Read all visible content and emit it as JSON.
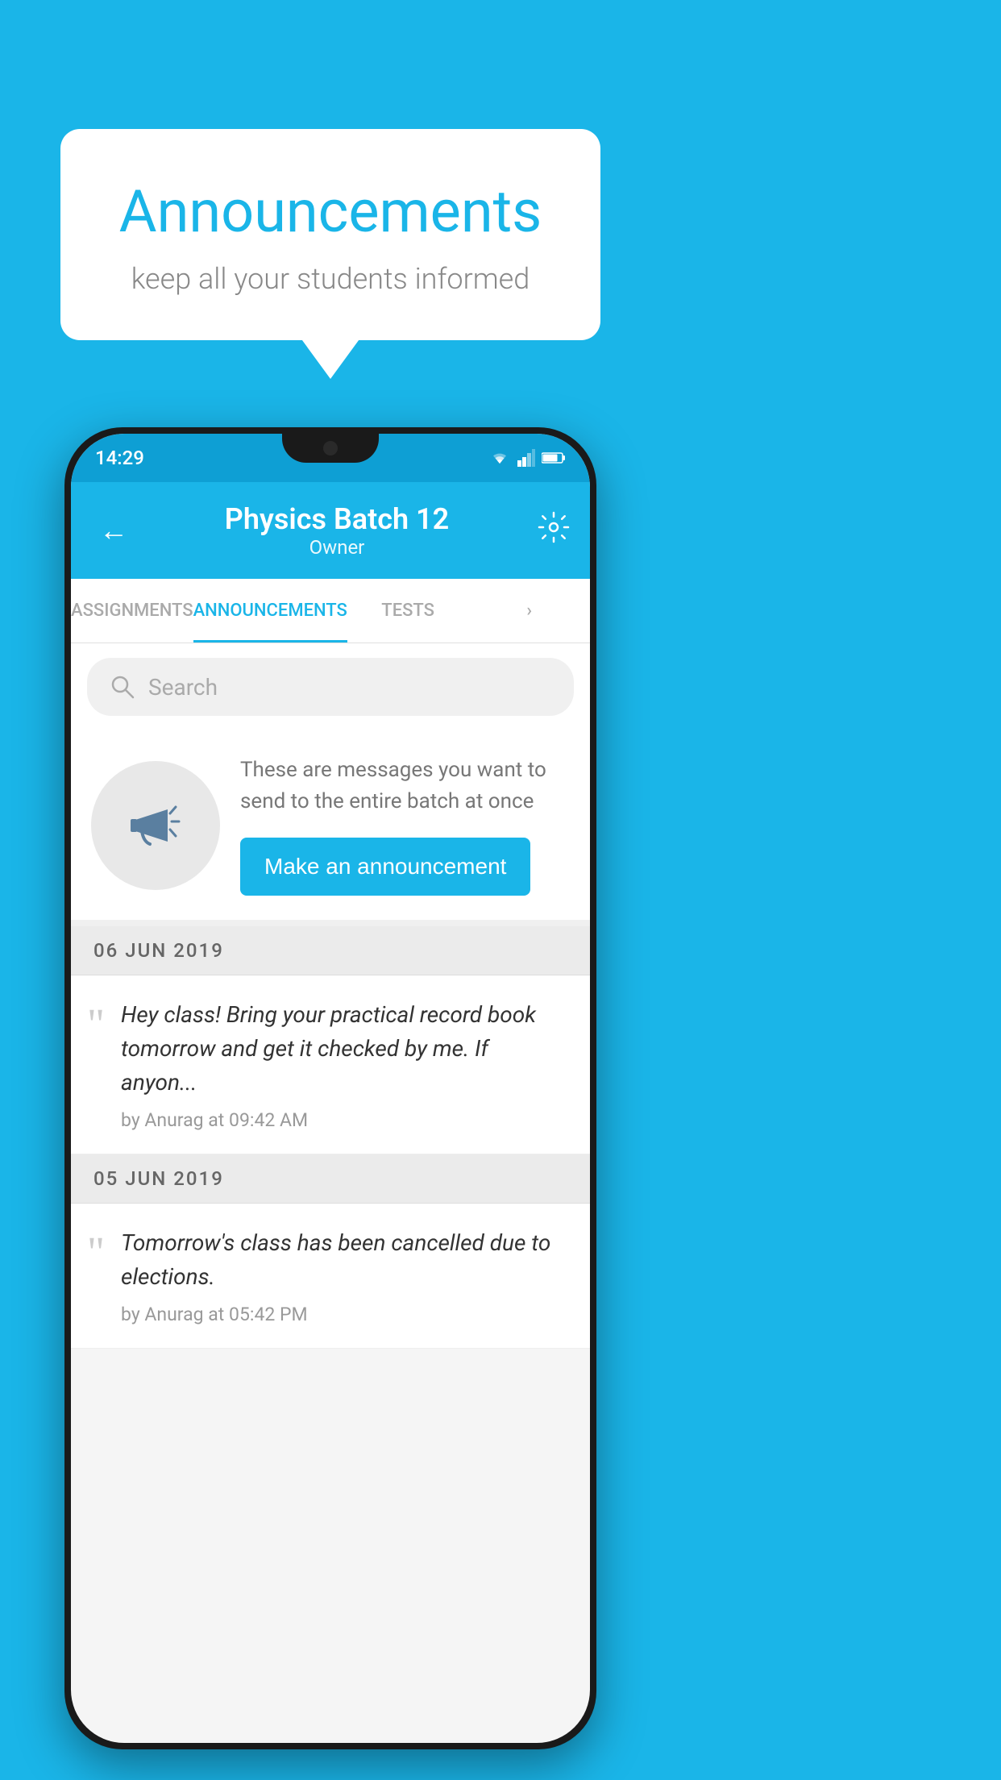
{
  "background_color": "#1ab5e8",
  "speech_bubble": {
    "title": "Announcements",
    "subtitle": "keep all your students informed"
  },
  "phone": {
    "status_bar": {
      "time": "14:29"
    },
    "header": {
      "title": "Physics Batch 12",
      "subtitle": "Owner",
      "back_label": "←"
    },
    "tabs": [
      {
        "label": "ASSIGNMENTS",
        "active": false
      },
      {
        "label": "ANNOUNCEMENTS",
        "active": true
      },
      {
        "label": "TESTS",
        "active": false
      },
      {
        "label": "...",
        "active": false
      }
    ],
    "search": {
      "placeholder": "Search"
    },
    "announcement_prompt": {
      "description": "These are messages you want to send to the entire batch at once",
      "button_label": "Make an announcement"
    },
    "announcement_groups": [
      {
        "date": "06  JUN  2019",
        "items": [
          {
            "text": "Hey class! Bring your practical record book tomorrow and get it checked by me. If anyon...",
            "meta": "by Anurag at 09:42 AM"
          }
        ]
      },
      {
        "date": "05  JUN  2019",
        "items": [
          {
            "text": "Tomorrow's class has been cancelled due to elections.",
            "meta": "by Anurag at 05:42 PM"
          }
        ]
      }
    ]
  }
}
